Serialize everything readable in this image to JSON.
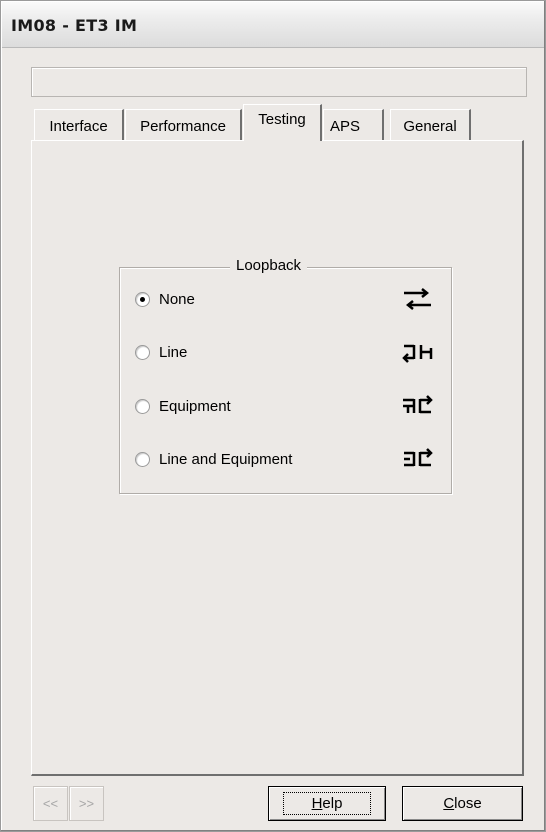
{
  "window": {
    "title": "IM08 - ET3 IM"
  },
  "status_field": {
    "value": ""
  },
  "tabs": [
    {
      "label": "Interface",
      "active": false
    },
    {
      "label": "Performance",
      "active": false
    },
    {
      "label": "Testing",
      "active": true
    },
    {
      "label": "APS",
      "active": false
    },
    {
      "label": "General",
      "active": false
    }
  ],
  "loopback": {
    "title": "Loopback",
    "selected": "None",
    "options": [
      {
        "label": "None",
        "icon": "loopback-none-icon",
        "checked": true
      },
      {
        "label": "Line",
        "icon": "loopback-line-icon",
        "checked": false
      },
      {
        "label": "Equipment",
        "icon": "loopback-equipment-icon",
        "checked": false
      },
      {
        "label": "Line and Equipment",
        "icon": "loopback-line-and-equipment-icon",
        "checked": false
      }
    ]
  },
  "footer": {
    "prev_label": "<<",
    "next_label": ">>",
    "help_first": "H",
    "help_rest": "elp",
    "close_first": "C",
    "close_rest": "lose"
  }
}
